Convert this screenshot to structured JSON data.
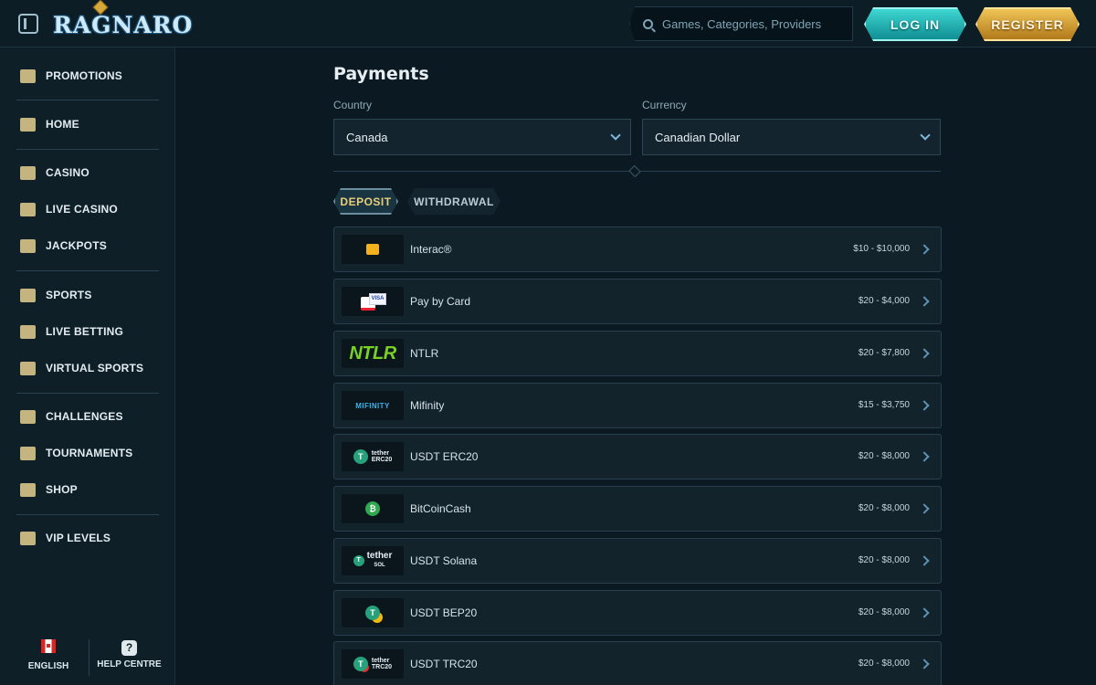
{
  "header": {
    "logo": "RAGNARO",
    "search_placeholder": "Games, Categories, Providers",
    "login_label": "LOG IN",
    "register_label": "REGISTER",
    "colors": {
      "login": "#1fb7b6",
      "register": "#d8a136"
    }
  },
  "sidebar": {
    "items": [
      {
        "label": "PROMOTIONS",
        "icon": "gift-icon"
      },
      {
        "label": "HOME",
        "icon": "home-icon"
      },
      {
        "label": "CASINO",
        "icon": "slot-machine-icon"
      },
      {
        "label": "LIVE CASINO",
        "icon": "cards-icon"
      },
      {
        "label": "JACKPOTS",
        "icon": "clover-icon"
      },
      {
        "label": "SPORTS",
        "icon": "soccer-ball-icon"
      },
      {
        "label": "LIVE BETTING",
        "icon": "live-icon"
      },
      {
        "label": "VIRTUAL SPORTS",
        "icon": "gamepad-icon"
      },
      {
        "label": "CHALLENGES",
        "icon": "badge-icon"
      },
      {
        "label": "TOURNAMENTS",
        "icon": "trophy-icon"
      },
      {
        "label": "SHOP",
        "icon": "shop-icon"
      },
      {
        "label": "VIP LEVELS",
        "icon": "diamond-icon"
      }
    ],
    "footer": {
      "language_label": "ENGLISH",
      "help_label": "HELP CENTRE"
    }
  },
  "main": {
    "title": "Payments",
    "country_label": "Country",
    "country_value": "Canada",
    "currency_label": "Currency",
    "currency_value": "Canadian Dollar",
    "tabs": {
      "deposit": "DEPOSIT",
      "withdrawal": "WITHDRAWAL"
    },
    "methods": [
      {
        "name": "Interac®",
        "range": "$10 - $10,000",
        "logo": "interac-icon"
      },
      {
        "name": "Pay by Card",
        "range": "$20 - $4,000",
        "logo": "card-icon"
      },
      {
        "name": "NTLR",
        "range": "$20 - $7,800",
        "logo": "ntlr-logo",
        "logo_text": "NTLR"
      },
      {
        "name": "Mifinity",
        "range": "$15 - $3,750",
        "logo": "mifinity-logo",
        "logo_text": "MIFINITY"
      },
      {
        "name": "USDT ERC20",
        "range": "$20 - $8,000",
        "logo": "tether-erc20-icon",
        "logo_text": "tether",
        "logo_sub": "ERC20"
      },
      {
        "name": "BitCoinCash",
        "range": "$20 - $8,000",
        "logo": "bitcoin-cash-icon"
      },
      {
        "name": "USDT Solana",
        "range": "$20 - $8,000",
        "logo": "tether-sol-icon",
        "logo_text": "tether",
        "logo_sub": "SOL"
      },
      {
        "name": "USDT BEP20",
        "range": "$20 - $8,000",
        "logo": "tether-bep20-icon"
      },
      {
        "name": "USDT TRC20",
        "range": "$20 - $8,000",
        "logo": "tether-trc20-icon",
        "logo_text": "tether",
        "logo_sub": "TRC20"
      }
    ]
  }
}
